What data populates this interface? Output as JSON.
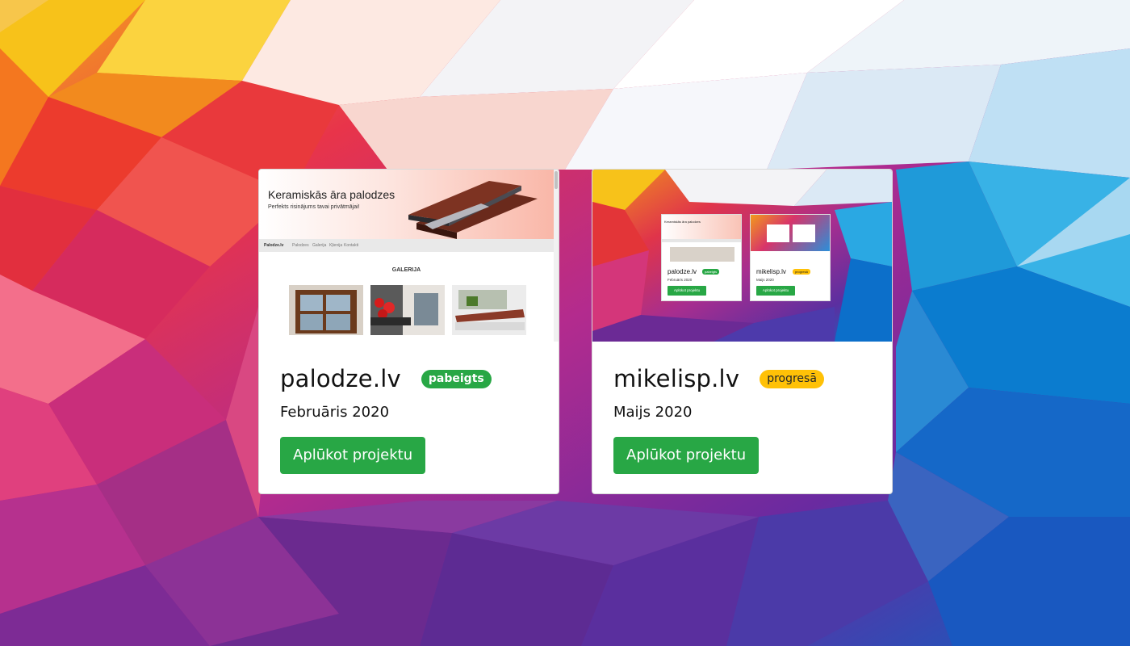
{
  "colors": {
    "accent_green": "#28a745",
    "badge_yellow": "#ffc107"
  },
  "projects": [
    {
      "title": "palodze.lv",
      "status": "pabeigts",
      "status_color": "#28a745",
      "date": "Februāris 2020",
      "button_label": "Aplūkot projektu",
      "thumbnail": {
        "heading": "Keramiskās āra palodzes",
        "subheading": "Perfekts risinājums tavai privātmājai!",
        "nav_brand": "Palodze.lv",
        "nav_items": [
          "Palodzes",
          "Galerija",
          "Kļienija",
          "Kontakti"
        ],
        "section_title": "GALERIJA"
      }
    },
    {
      "title": "mikelisp.lv",
      "status": "progresā",
      "status_color": "#ffc107",
      "date": "Maijs 2020",
      "button_label": "Aplūkot projektu",
      "thumbnail": {
        "mini_cards": [
          {
            "title": "palodze.lv",
            "badge": "pabeigts",
            "date": "Februāris 2020",
            "button": "Aplūkot projektu"
          },
          {
            "title": "mikelisp.lv",
            "badge": "progresā",
            "date": "Maijs 2020",
            "button": "Aplūkot projektu"
          }
        ],
        "mini_heading": "Keramiskās āra palodzes"
      }
    }
  ]
}
